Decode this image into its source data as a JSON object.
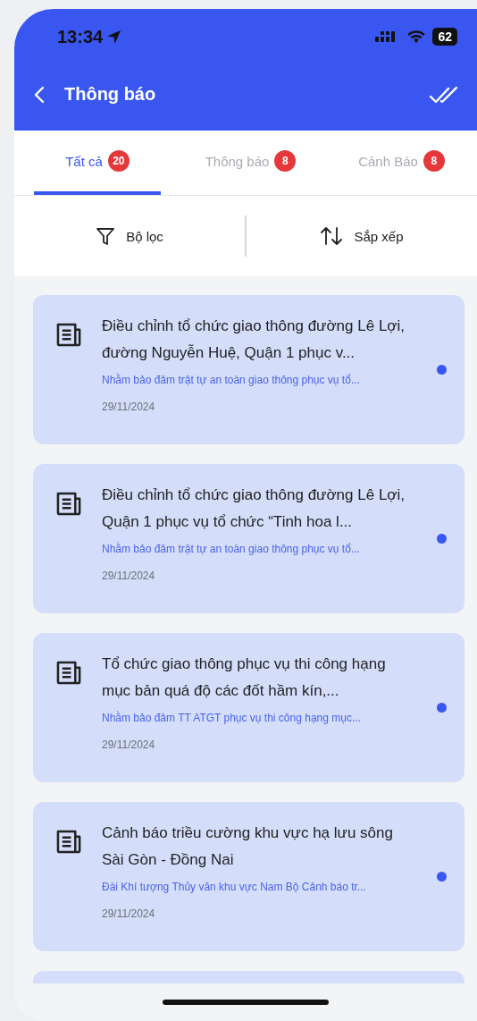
{
  "status_bar": {
    "time": "13:34",
    "battery": "62"
  },
  "header": {
    "title": "Thông báo"
  },
  "tabs": [
    {
      "label": "Tất cả",
      "count": "20",
      "selected": true
    },
    {
      "label": "Thông báo",
      "count": "8",
      "selected": false
    },
    {
      "label": "Cảnh Báo",
      "count": "8",
      "selected": false
    }
  ],
  "toolbar": {
    "filter": "Bộ lọc",
    "sort": "Sắp xếp"
  },
  "notifications": [
    {
      "title": "Điều chỉnh tổ chức giao thông đường Lê Lợi, đường Nguyễn Huệ, Quận 1 phục v...",
      "summary": "Nhằm bảo đảm trật tự an toàn giao thông phục vụ tổ...",
      "date": "29/11/2024",
      "unread": true
    },
    {
      "title": "Điều chỉnh tổ chức giao thông đường Lê Lợi, Quận 1 phục vụ tổ chức “Tinh hoa l...",
      "summary": "Nhằm bảo đảm trật tự an toàn giao thông phục vụ tổ...",
      "date": "29/11/2024",
      "unread": true
    },
    {
      "title": "Tổ chức giao thông phục vụ thi công hạng mục bản quá độ các đốt hầm kín,...",
      "summary": "Nhằm bảo đảm TT ATGT phục vụ thi công hạng mục...",
      "date": "29/11/2024",
      "unread": true
    },
    {
      "title": "Cảnh báo triều cường khu vực hạ lưu sông Sài Gòn - Đồng Nai",
      "summary": "Đài Khí tượng Thủy văn khu  vực Nam Bộ Cảnh báo tr...",
      "date": "29/11/2024",
      "unread": true
    }
  ]
}
